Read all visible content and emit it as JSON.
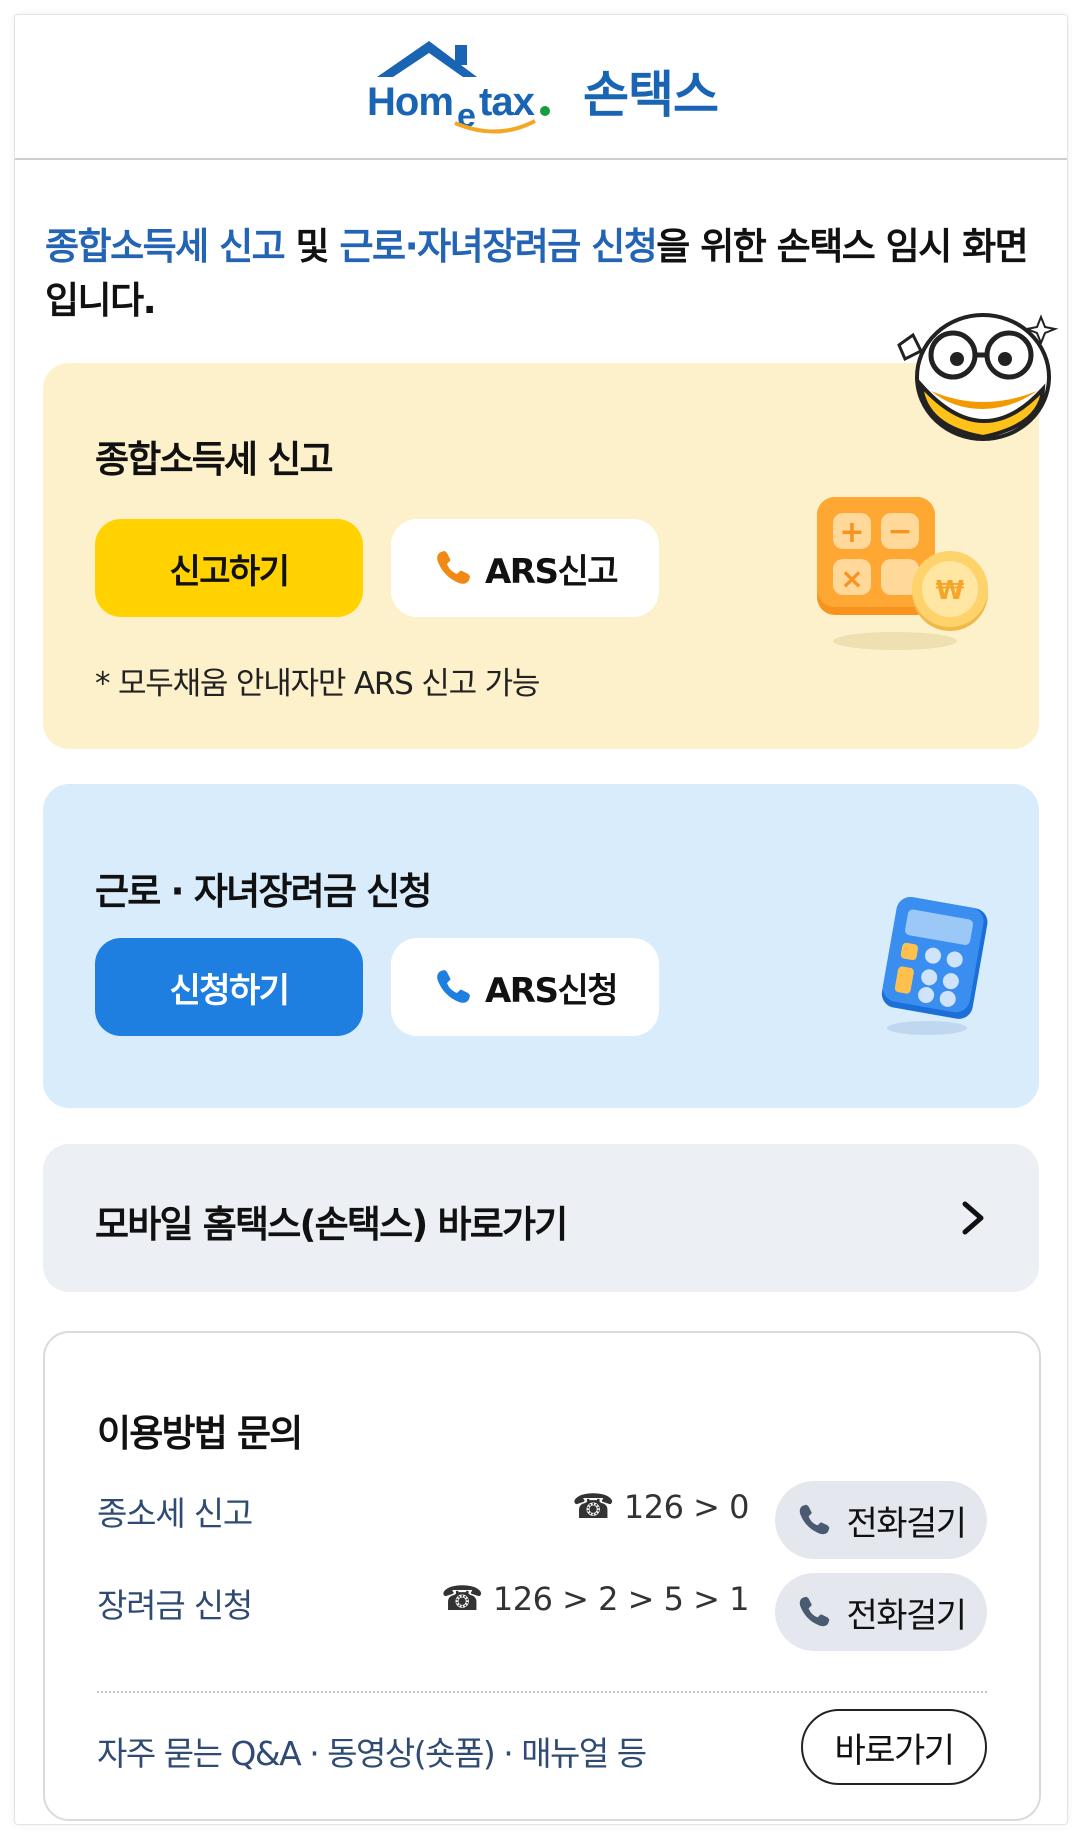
{
  "header": {
    "logo_text": "Hometax.",
    "brand_name": "손택스"
  },
  "intro": {
    "highlight_1": "종합소득세 신고",
    "connector": " 및 ",
    "highlight_2": "근로·자녀장려금 신청",
    "rest": "을 위한 손택스 임시 화면입니다."
  },
  "tax_card": {
    "title": "종합소득세 신고",
    "primary_button": "신고하기",
    "ars_button": "ARS신고",
    "note": "* 모두채움 안내자만 ARS 신고 가능",
    "icon": "calculator-coin-icon"
  },
  "reward_card": {
    "title": "근로 · 자녀장려금 신청",
    "primary_button": "신청하기",
    "ars_button": "ARS신청",
    "icon": "calculator-icon"
  },
  "mobile_link": {
    "label": "모바일 홈택스(손택스) 바로가기",
    "icon": "chevron-right-icon"
  },
  "inquiry": {
    "title": "이용방법 문의",
    "rows": [
      {
        "label": "종소세 신고",
        "number": "126 > 0",
        "button": "전화걸기"
      },
      {
        "label": "장려금 신청",
        "number": "126 > 2 > 5 > 1",
        "button": "전화걸기"
      }
    ],
    "faq_label": "자주 묻는 Q&A · 동영상(숏폼) · 매뉴얼 등",
    "faq_button": "바로가기"
  },
  "colors": {
    "brand_blue": "#1a64b4",
    "highlight_blue": "#2464b4",
    "tax_card_bg": "#fdf1cc",
    "reward_card_bg": "#d9ecfb",
    "yellow_button": "#ffd200",
    "blue_button": "#1f7fe0",
    "link_bar_bg": "#eceff4"
  }
}
